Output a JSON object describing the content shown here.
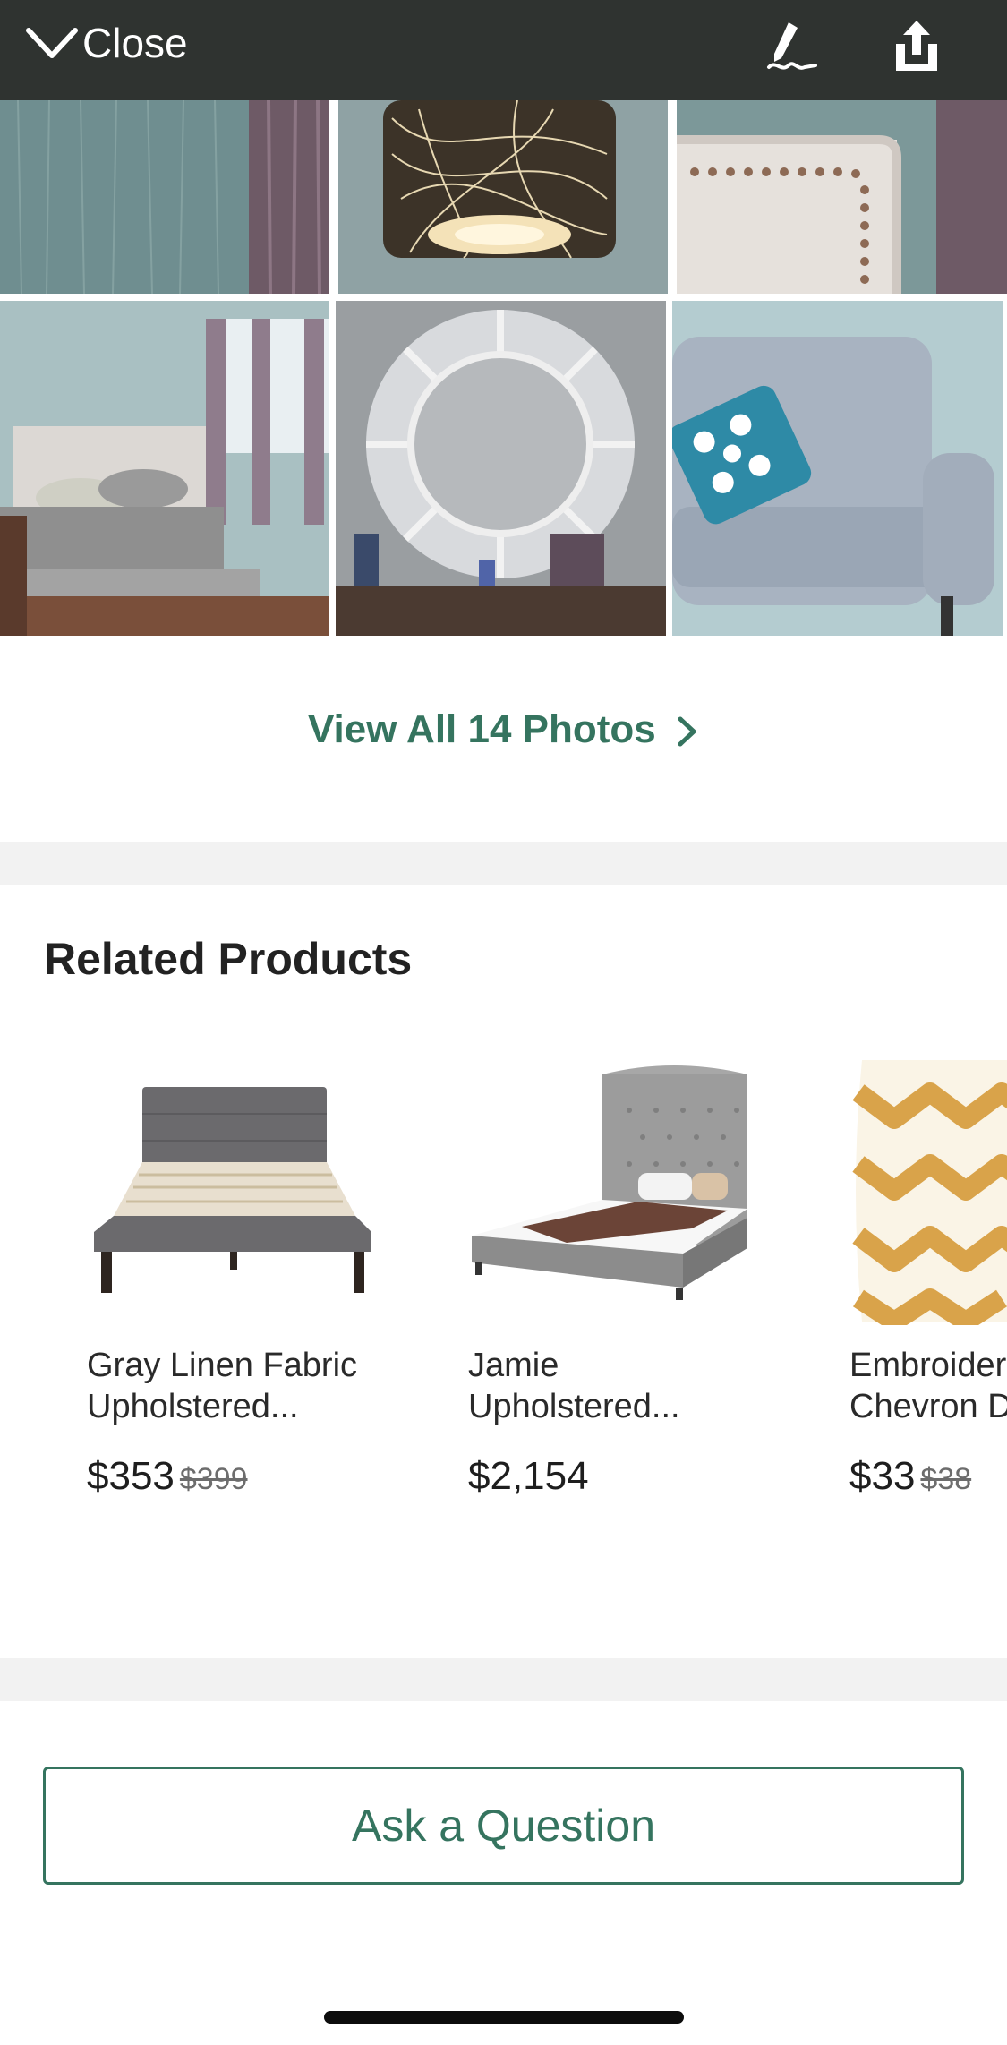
{
  "header": {
    "close_label": "Close",
    "icons": [
      "chevron-down-icon",
      "pen-signature-icon",
      "share-icon"
    ]
  },
  "photos": {
    "view_all_label": "View All 14 Photos"
  },
  "related": {
    "title": "Related Products",
    "products": [
      {
        "name_line1": "Gray Linen Fabric",
        "name_line2": "Upholstered...",
        "price": "$353",
        "old_price": "$399"
      },
      {
        "name_line1": "Jamie",
        "name_line2": "Upholstered...",
        "price": "$2,154",
        "old_price": ""
      },
      {
        "name_line1": "Embroider",
        "name_line2": "Chevron D",
        "price": "$33",
        "old_price": "$38"
      }
    ]
  },
  "ask": {
    "label": "Ask a Question"
  },
  "colors": {
    "accent": "#35745f",
    "topbar": "#2f3330",
    "separator": "#f2f2f2"
  }
}
